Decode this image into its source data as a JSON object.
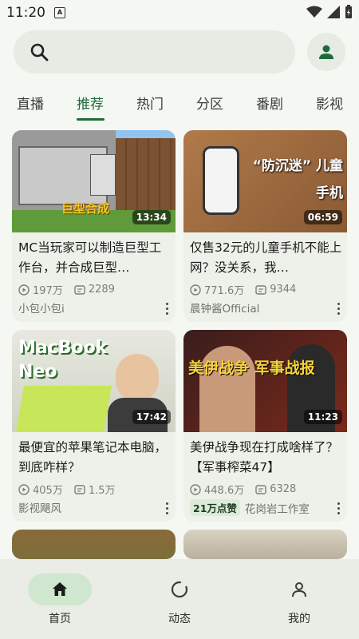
{
  "status": {
    "time": "11:20",
    "badge": "A"
  },
  "tabs": [
    "直播",
    "推荐",
    "热门",
    "分区",
    "番剧",
    "影视"
  ],
  "active_tab": "推荐",
  "cards": [
    {
      "title": "MC当玩家可以制造巨型工作台，并合成巨型…",
      "duration": "13:34",
      "views": "197万",
      "danmaku": "2289",
      "author": "小包小包i",
      "likes": "",
      "thumb_text": "巨型合成"
    },
    {
      "title": "仅售32元的儿童手机不能上网？没关系，我…",
      "duration": "06:59",
      "views": "771.6万",
      "danmaku": "9344",
      "author": "晨钟酱Official",
      "likes": "",
      "thumb_text": "“防沉迷” 儿童手机"
    },
    {
      "title": "最便宜的苹果笔记本电脑，到底咋样？",
      "duration": "17:42",
      "views": "405万",
      "danmaku": "1.5万",
      "author": "影视飓风",
      "likes": "",
      "thumb_text": "MacBook Neo"
    },
    {
      "title": "美伊战争现在打成啥样了？【军事榨菜47】",
      "duration": "11:23",
      "views": "448.6万",
      "danmaku": "6328",
      "author": "花岗岩工作室",
      "likes": "21万点赞",
      "thumb_text": "美伊战争 军事战报"
    }
  ],
  "nav": [
    {
      "label": "首页",
      "icon": "home-icon"
    },
    {
      "label": "动态",
      "icon": "refresh-icon"
    },
    {
      "label": "我的",
      "icon": "person-icon"
    }
  ],
  "colors": {
    "accent": "#1e6b3a",
    "background": "#f5f7f2",
    "card": "#eef1ea"
  }
}
